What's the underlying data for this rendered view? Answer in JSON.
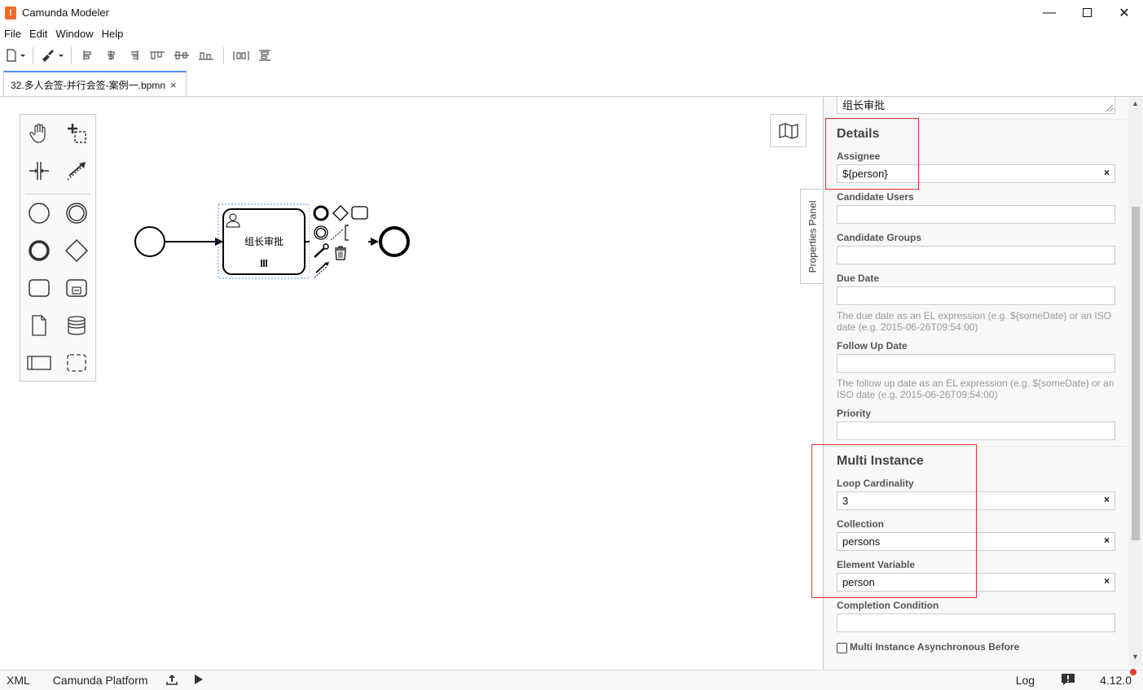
{
  "window": {
    "title": "Camunda Modeler",
    "logo_glyph": "!",
    "controls": [
      "minimize-icon",
      "maximize-icon",
      "close-icon"
    ]
  },
  "menu": [
    "File",
    "Edit",
    "Window",
    "Help"
  ],
  "tab": {
    "label": "32.多人会签-并行会签-案例一.bpmn",
    "close": "×"
  },
  "diagram": {
    "task_name": "组长审批"
  },
  "panel_toggle_label": "Properties Panel",
  "properties": {
    "name_value": "组长审批",
    "details": {
      "title": "Details",
      "assignee_label": "Assignee",
      "assignee_value": "${person}",
      "candidate_users_label": "Candidate Users",
      "candidate_groups_label": "Candidate Groups",
      "due_date_label": "Due Date",
      "due_date_desc": "The due date as an EL expression (e.g. ${someDate} or an ISO date (e.g. 2015-06-26T09:54:00)",
      "follow_up_label": "Follow Up Date",
      "follow_up_desc": "The follow up date as an EL expression (e.g. ${someDate} or an ISO date (e.g. 2015-06-26T09:54:00)",
      "priority_label": "Priority"
    },
    "multi_instance": {
      "title": "Multi Instance",
      "loop_cardinality_label": "Loop Cardinality",
      "loop_cardinality_value": "3",
      "collection_label": "Collection",
      "collection_value": "persons",
      "element_variable_label": "Element Variable",
      "element_variable_value": "person",
      "completion_condition_label": "Completion Condition",
      "async_before_label": "Multi Instance Asynchronous Before"
    },
    "clear_glyph": "×"
  },
  "statusbar": {
    "xml": "XML",
    "platform": "Camunda Platform",
    "log": "Log",
    "version": "4.12.0"
  },
  "colors": {
    "accent": "#4d90fe",
    "highlight": "#e03030",
    "logo": "#f16a28",
    "update_dot": "#e53935"
  }
}
